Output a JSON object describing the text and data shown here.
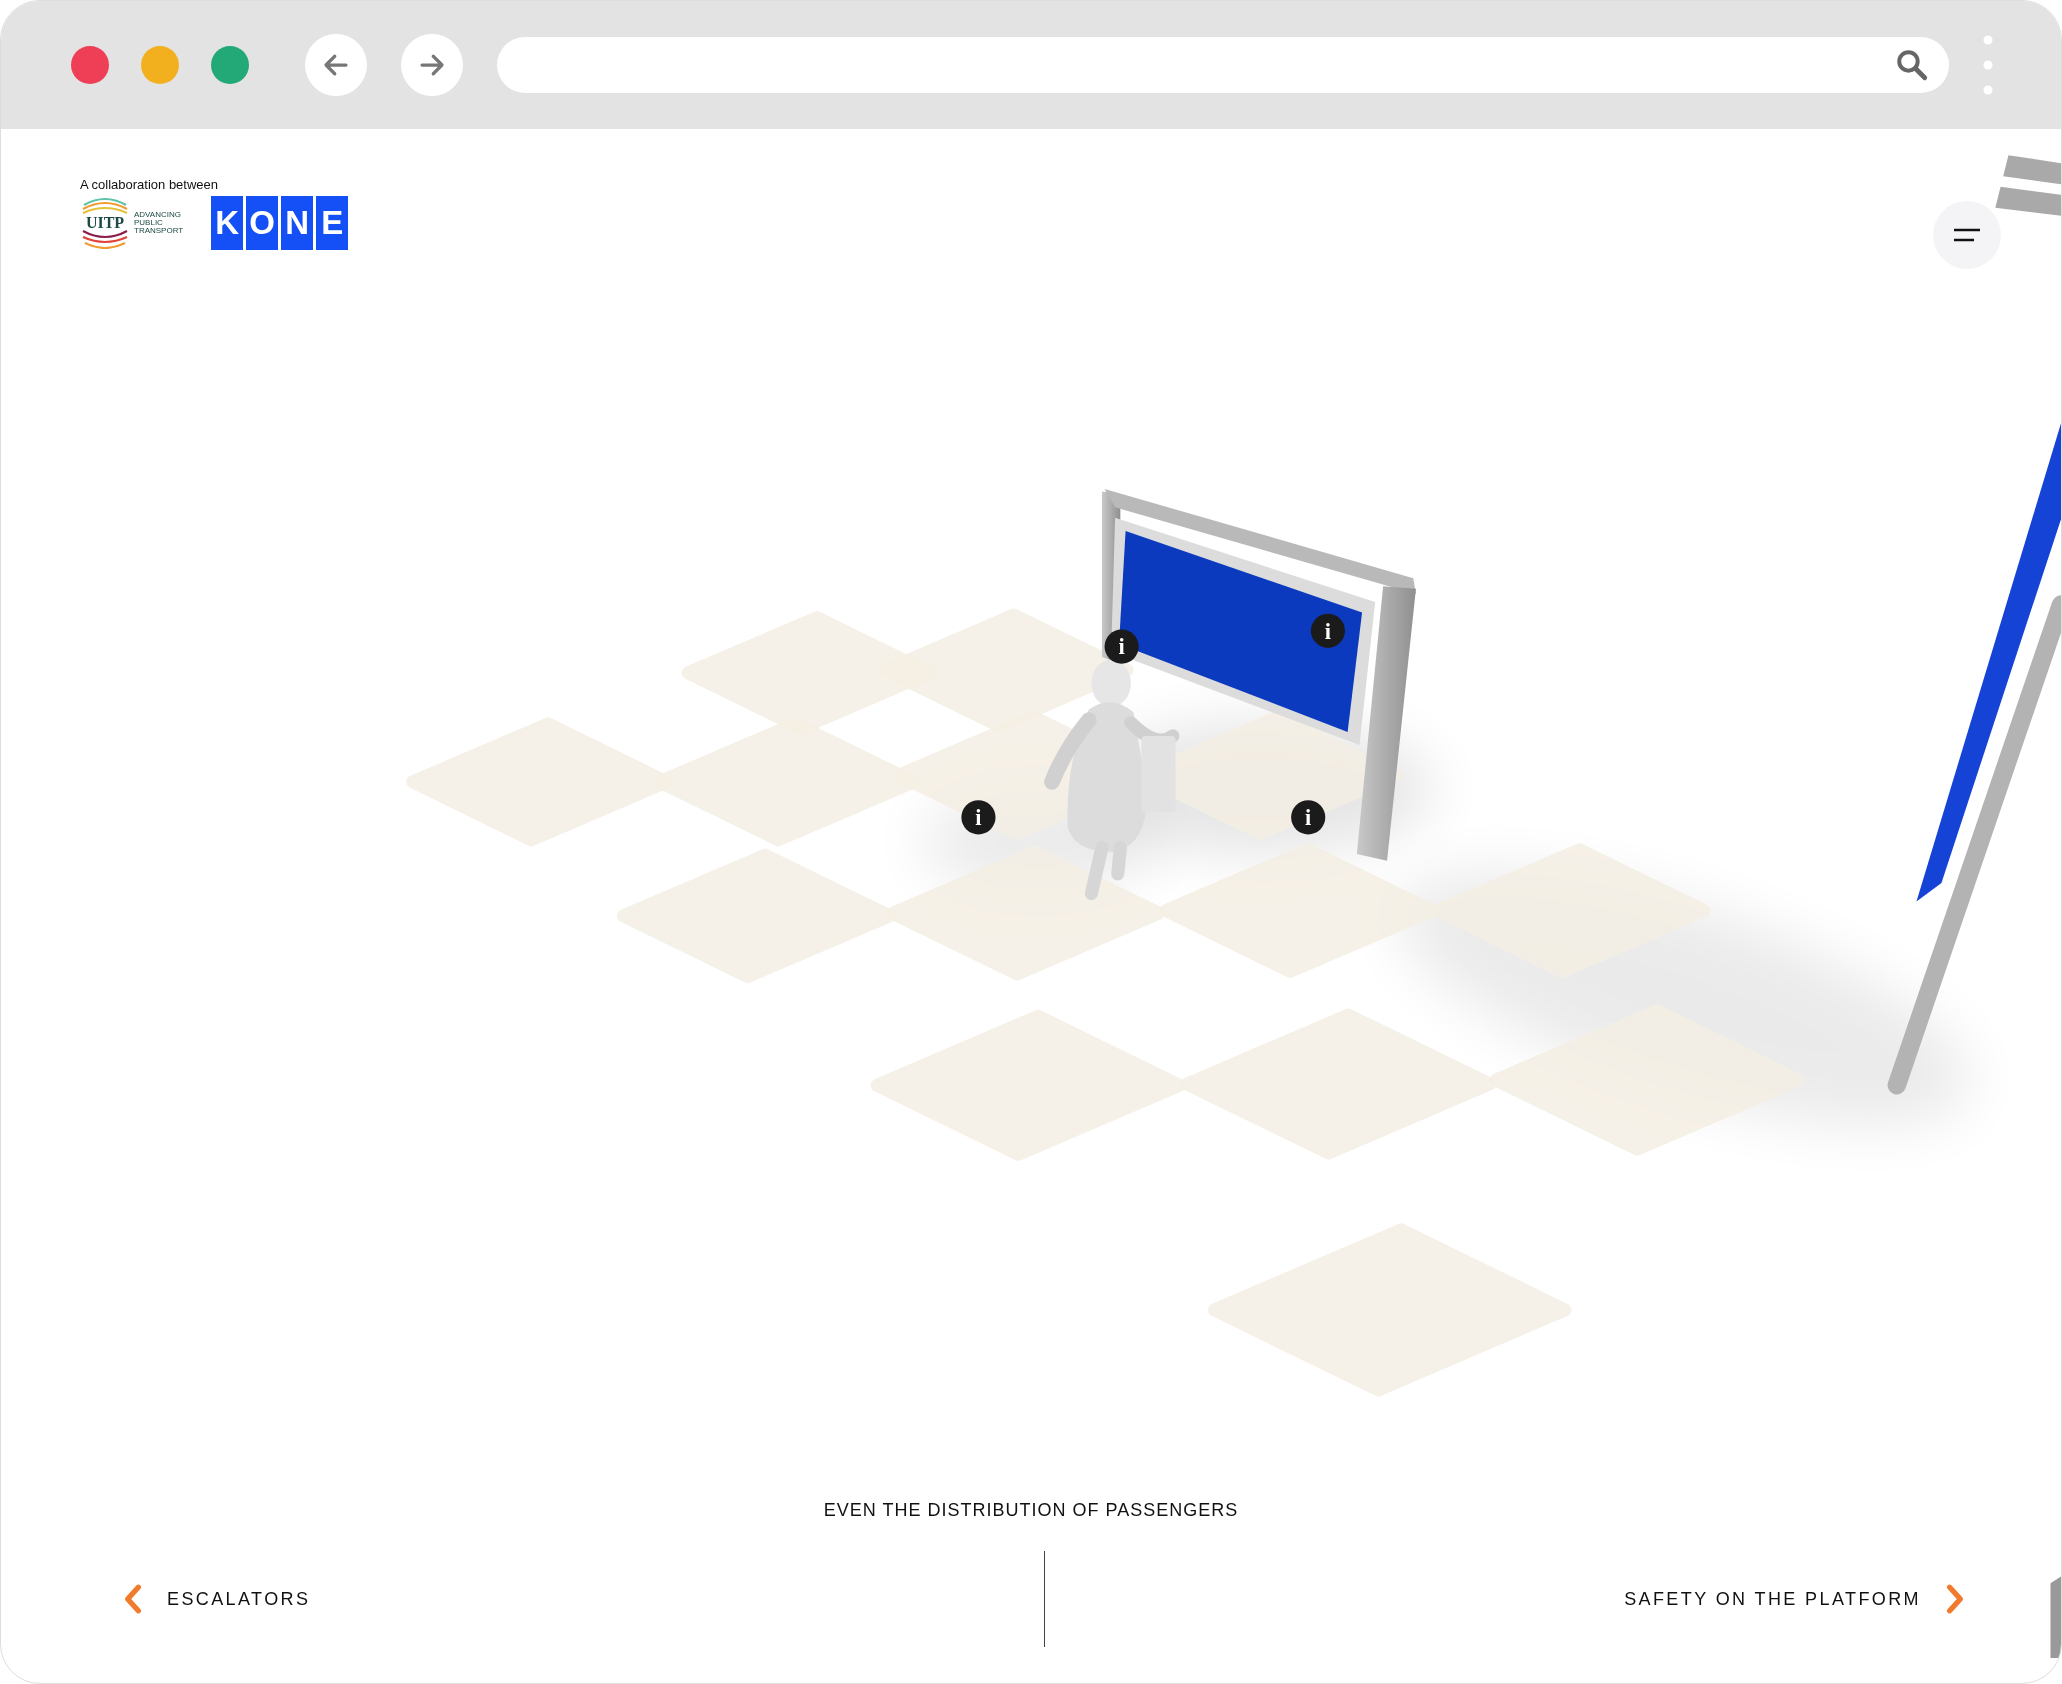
{
  "browser": {
    "window_controls": [
      {
        "color": "#ee3f57"
      },
      {
        "color": "#f3b01e"
      },
      {
        "color": "#23a877"
      }
    ]
  },
  "header": {
    "caption": "A collaboration between",
    "uitp": {
      "mark": "UITP",
      "tagline": [
        "ADVANCING",
        "PUBLIC",
        "TRANSPORT"
      ]
    },
    "kone_letters": [
      "K",
      "O",
      "N",
      "E"
    ]
  },
  "hotspots": [
    {
      "label": "i"
    },
    {
      "label": "i"
    },
    {
      "label": "i"
    },
    {
      "label": "i"
    }
  ],
  "caption": "EVEN THE DISTRIBUTION OF PASSENGERS",
  "nav": {
    "previous": "ESCALATORS",
    "next": "SAFETY ON THE PLATFORM"
  }
}
